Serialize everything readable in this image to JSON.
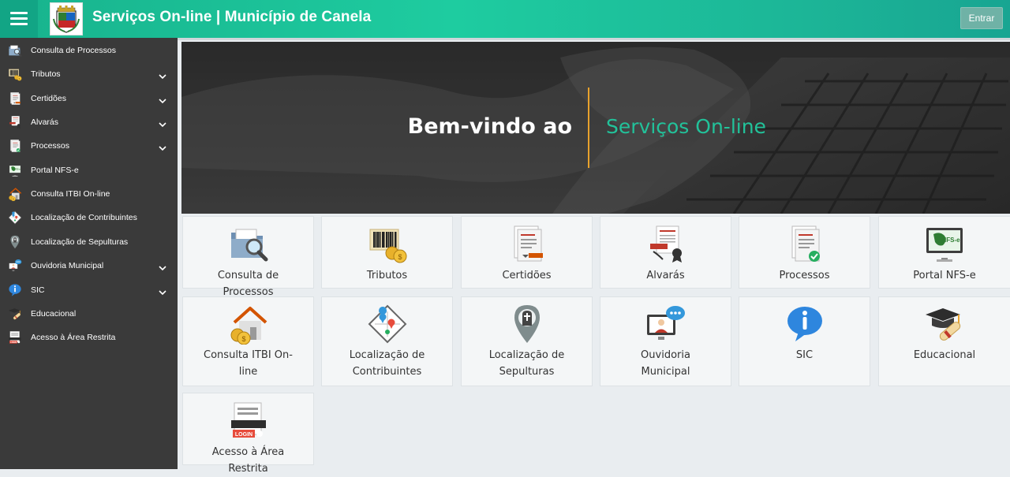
{
  "header": {
    "title": "Serviços On-line | Município de Canela",
    "login_label": "Entrar"
  },
  "sidebar": {
    "items": [
      {
        "label": "Consulta de Processos",
        "icon": "folder-search-icon",
        "has_submenu": false
      },
      {
        "label": "Tributos",
        "icon": "barcode-coins-icon",
        "has_submenu": true
      },
      {
        "label": "Certidões",
        "icon": "certificate-icon",
        "has_submenu": true
      },
      {
        "label": "Alvarás",
        "icon": "permit-icon",
        "has_submenu": true
      },
      {
        "label": "Processos",
        "icon": "document-check-icon",
        "has_submenu": true
      },
      {
        "label": "Portal NFS-e",
        "icon": "monitor-nfse-icon",
        "has_submenu": false
      },
      {
        "label": "Consulta ITBI On-line",
        "icon": "house-coins-icon",
        "has_submenu": false
      },
      {
        "label": "Localização de Contribuintes",
        "icon": "map-pin-icon",
        "has_submenu": false
      },
      {
        "label": "Localização de Sepulturas",
        "icon": "grave-pin-icon",
        "has_submenu": false
      },
      {
        "label": "Ouvidoria Municipal",
        "icon": "ombudsman-icon",
        "has_submenu": true
      },
      {
        "label": "SIC",
        "icon": "info-bubble-icon",
        "has_submenu": true
      },
      {
        "label": "Educacional",
        "icon": "graduation-icon",
        "has_submenu": false
      },
      {
        "label": "Acesso à Área Restrita",
        "icon": "login-icon",
        "has_submenu": false
      }
    ]
  },
  "hero": {
    "welcome": "Bem-vindo ao",
    "service_name": "Serviços On-line"
  },
  "tiles": [
    {
      "label": "Consulta de Processos",
      "icon": "folder-search-icon"
    },
    {
      "label": "Tributos",
      "icon": "barcode-coins-icon"
    },
    {
      "label": "Certidões",
      "icon": "certificate-icon"
    },
    {
      "label": "Alvarás",
      "icon": "permit-icon"
    },
    {
      "label": "Processos",
      "icon": "document-check-icon"
    },
    {
      "label": "Portal NFS-e",
      "icon": "monitor-nfse-icon"
    },
    {
      "label": "Consulta ITBI On-line",
      "icon": "house-coins-icon"
    },
    {
      "label": "Localização de Contribuintes",
      "icon": "map-pin-icon"
    },
    {
      "label": "Localização de Sepulturas",
      "icon": "grave-pin-icon"
    },
    {
      "label": "Ouvidoria Municipal",
      "icon": "ombudsman-icon"
    },
    {
      "label": "SIC",
      "icon": "info-bubble-icon"
    },
    {
      "label": "Educacional",
      "icon": "graduation-icon"
    },
    {
      "label": "Acesso à Área Restrita",
      "icon": "login-icon"
    }
  ],
  "icon_text": {
    "nfse": "NFS-e",
    "login": "LOGIN"
  },
  "colors": {
    "accent": "#1ecca0",
    "sidebar": "#3a3a3a",
    "divider": "#e8a22c"
  }
}
